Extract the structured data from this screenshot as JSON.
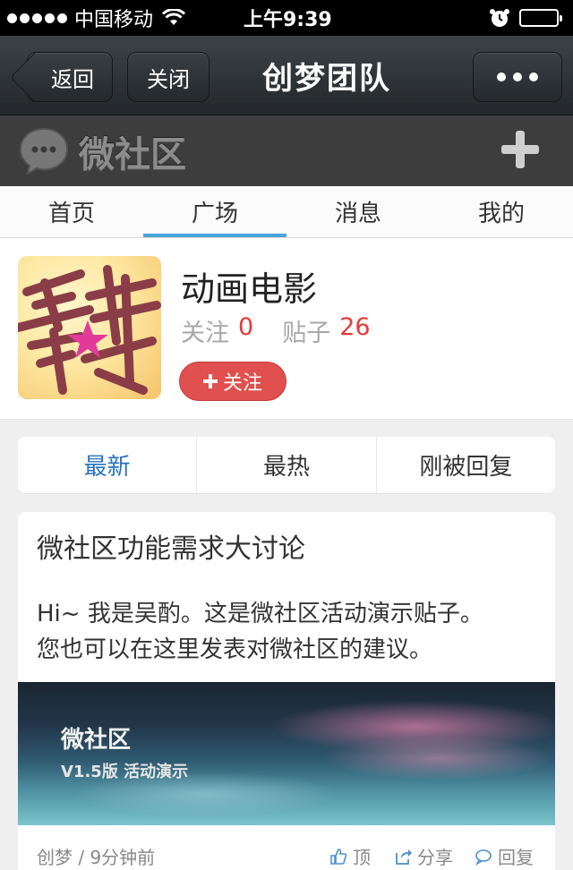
{
  "status_bar": {
    "carrier": "中国移动",
    "time": "上午9:39"
  },
  "nav": {
    "back_label": "返回",
    "close_label": "关闭",
    "title": "创梦团队"
  },
  "community": {
    "name": "微社区"
  },
  "tabs": [
    {
      "label": "首页"
    },
    {
      "label": "广场"
    },
    {
      "label": "消息"
    },
    {
      "label": "我的"
    }
  ],
  "group": {
    "title": "动画电影",
    "follow_label": "关注",
    "follow_count": "0",
    "posts_label": "贴子",
    "posts_count": "26",
    "follow_button": "关注"
  },
  "sort_tabs": [
    {
      "label": "最新"
    },
    {
      "label": "最热"
    },
    {
      "label": "刚被回复"
    }
  ],
  "post": {
    "title": "微社区功能需求大讨论",
    "body_line1": "Hi~ 我是吴酌。这是微社区活动演示贴子。",
    "body_line2": "您也可以在这里发表对微社区的建议。",
    "image_title": "微社区",
    "image_subtitle": "V1.5版 活动演示",
    "meta": "创梦 / 9分钟前",
    "like_label": "顶",
    "share_label": "分享",
    "reply_label": "回复"
  },
  "colors": {
    "accent_blue": "#4aa4de",
    "link_blue": "#2a72bf",
    "red": "#e53b3b",
    "nav_dark": "#2d3134"
  }
}
